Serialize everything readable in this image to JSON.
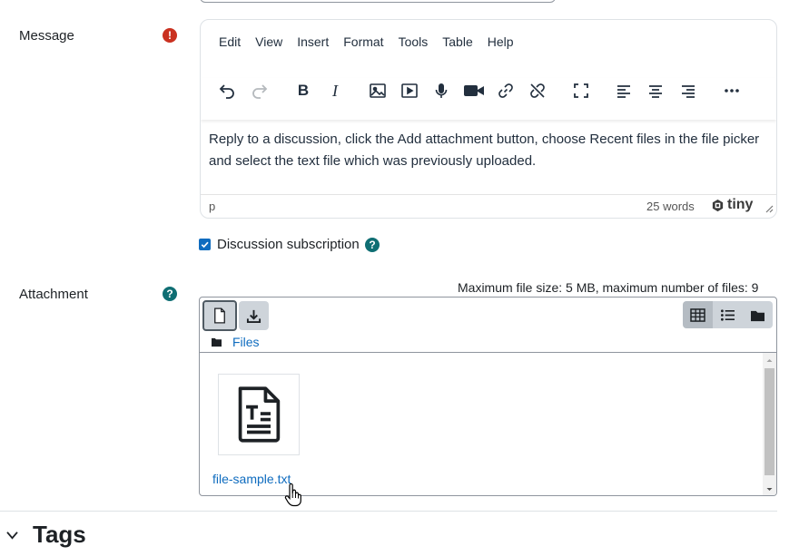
{
  "message": {
    "label": "Message",
    "required_icon": "exclamation-icon",
    "menubar": [
      "Edit",
      "View",
      "Insert",
      "Format",
      "Tools",
      "Table",
      "Help"
    ],
    "toolbar_icons": [
      "undo-icon",
      "redo-icon",
      "bold-icon",
      "italic-icon",
      "image-icon",
      "media-icon",
      "record-audio-icon",
      "record-video-icon",
      "link-icon",
      "unlink-icon",
      "fullscreen-icon",
      "align-left-icon",
      "align-center-icon",
      "align-right-icon",
      "more-icon"
    ],
    "content": "Reply to a discussion, click the Add attachment button, choose Recent files in the file picker and select the text file which was previously uploaded.",
    "status_path": "p",
    "word_count": "25 words",
    "brand": "tiny"
  },
  "subscription": {
    "label": "Discussion subscription",
    "checked": true
  },
  "attachment": {
    "label": "Attachment",
    "limits": "Maximum file size: 5 MB, maximum number of files: 9",
    "path_label": "Files",
    "file_name": "file-sample.txt"
  },
  "tags": {
    "title": "Tags"
  },
  "colors": {
    "required": "#ca3120",
    "help": "#0f6e73",
    "link": "#0f6cbf",
    "button_bg": "#ced4da"
  }
}
